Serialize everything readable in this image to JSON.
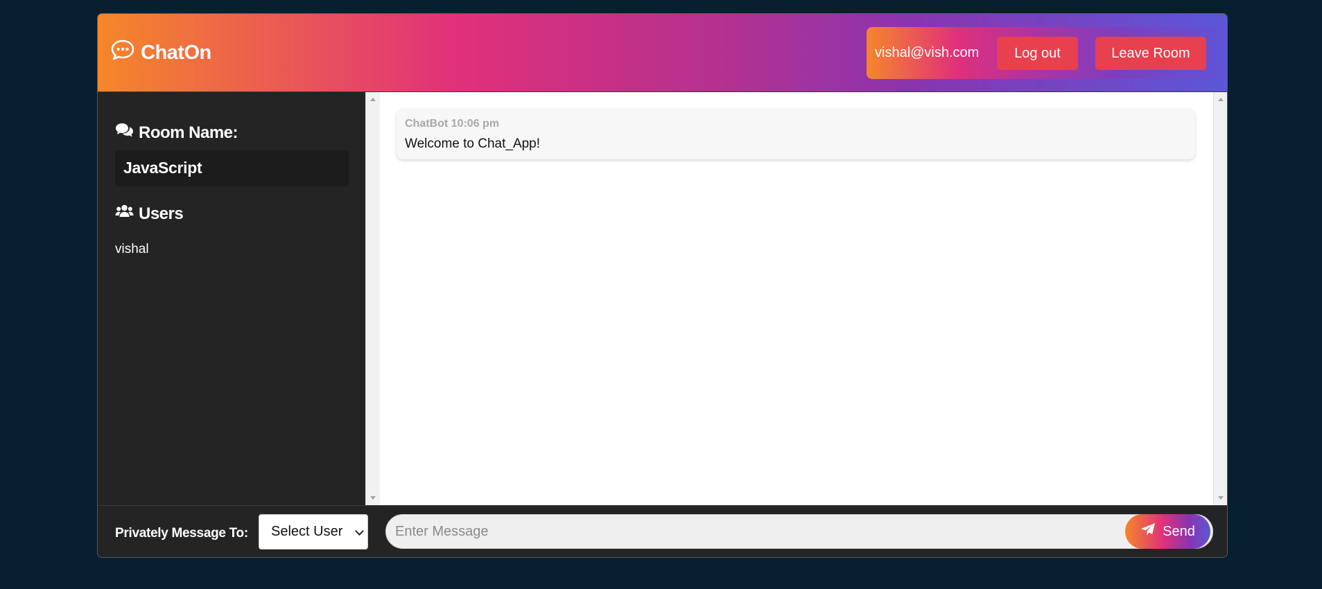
{
  "header": {
    "brand": "ChatOn",
    "user_email": "vishal@vish.com",
    "logout_label": "Log out",
    "leave_label": "Leave Room"
  },
  "sidebar": {
    "room_heading": "Room Name:",
    "room_name": "JavaScript",
    "users_heading": "Users",
    "users": [
      "vishal"
    ]
  },
  "messages": [
    {
      "author": "ChatBot",
      "time": "10:06 pm",
      "text": "Welcome to Chat_App!"
    }
  ],
  "footer": {
    "pm_label": "Privately Message To:",
    "select_value": "Select User",
    "message_placeholder": "Enter Message",
    "send_label": "Send"
  },
  "icons": {
    "brand": "comment-dots-icon",
    "room": "comments-icon",
    "users": "users-icon",
    "send": "paper-plane-icon"
  },
  "colors": {
    "page_bg": "#071f2e",
    "panel_bg": "#242424",
    "accent_red": "#e8404f",
    "gradient_start": "#f5862a",
    "gradient_mid": "#e0307a",
    "gradient_end": "#5b57d8"
  }
}
